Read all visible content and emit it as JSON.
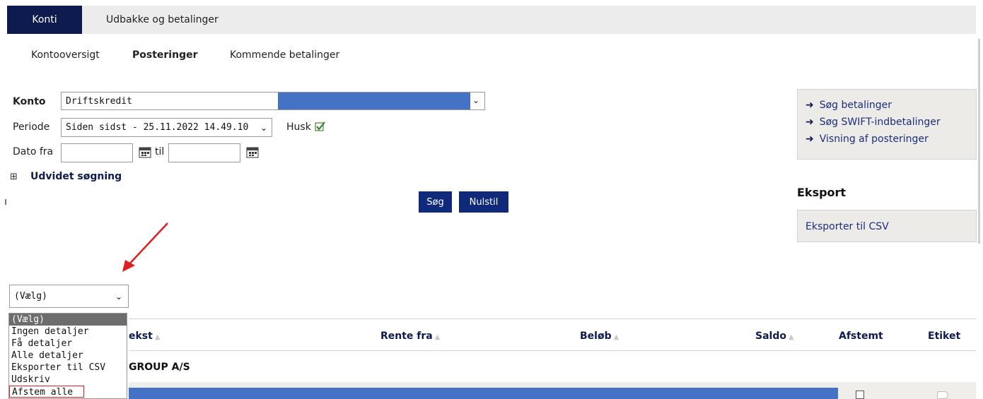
{
  "top_tabs": {
    "konti": "Konti",
    "udbakke": "Udbakke og betalinger"
  },
  "sub_nav": {
    "kontooversigt": "Kontooversigt",
    "posteringer": "Posteringer",
    "kommende": "Kommende betalinger"
  },
  "form": {
    "konto_label": "Konto",
    "konto_value": "Driftskredit",
    "periode_label": "Periode",
    "periode_value": "Siden sidst - 25.11.2022 14.49.10",
    "husk_label": "Husk",
    "dato_fra_label": "Dato fra",
    "til_label": "til",
    "dato_fra_value": "",
    "dato_til_value": "",
    "udvidet": "Udvidet søgning",
    "expand_symbol": "⊞"
  },
  "buttons": {
    "sog": "Søg",
    "nulstil": "Nulstil"
  },
  "side_links": [
    "Søg betalinger",
    "Søg SWIFT-indbetalinger",
    "Visning af posteringer"
  ],
  "eksport": {
    "title": "Eksport",
    "link": "Eksporter til CSV"
  },
  "action_select": {
    "selected": "(Vælg)",
    "options": [
      "(Vælg)",
      "Ingen detaljer",
      "Få detaljer",
      "Alle detaljer",
      "Eksporter til CSV",
      "Udskriv",
      "Afstem alle"
    ]
  },
  "table": {
    "headers": {
      "tekst": "ekst",
      "rente_fra": "Rente fra",
      "belob": "Beløb",
      "saldo": "Saldo",
      "afstemt": "Afstemt",
      "etiket": "Etiket"
    },
    "group_row": "GROUP A/S"
  },
  "colors": {
    "nav_dark": "#0d1b4f",
    "button": "#0f2a7a",
    "highlight": "#4472c4",
    "annotation": "#e02020"
  }
}
